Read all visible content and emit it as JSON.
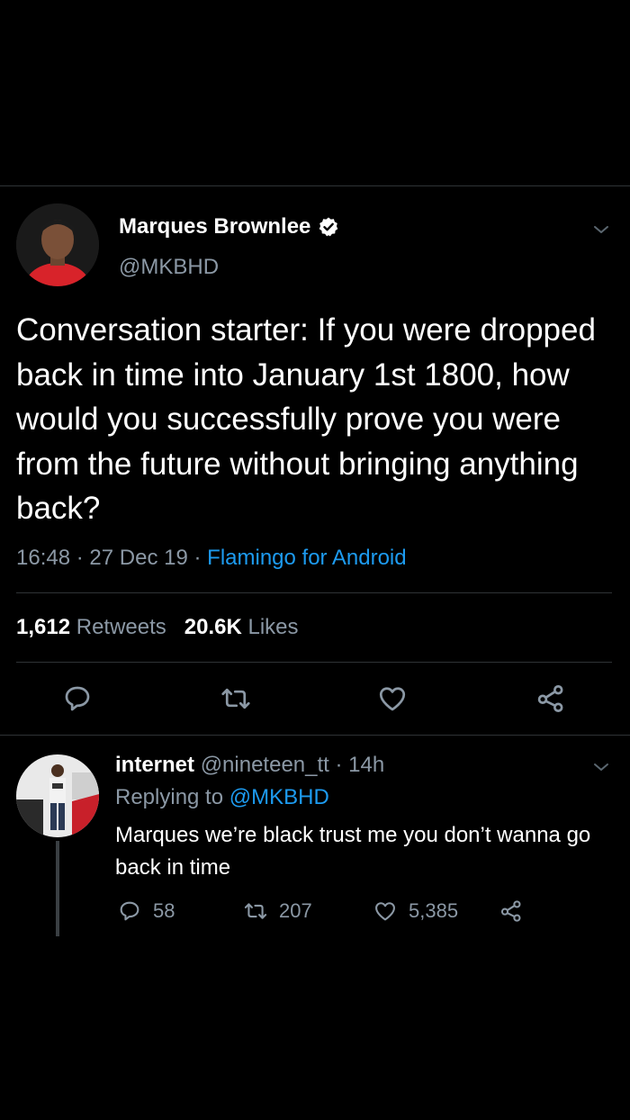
{
  "tweet": {
    "author": {
      "display_name": "Marques Brownlee",
      "handle": "@MKBHD",
      "verified": true
    },
    "text": "Conversation starter: If you were dropped back in time into January 1st 1800, how would you successfully prove you were from the future without bringing anything back?",
    "time": "16:48",
    "date": "27 Dec 19",
    "separator": "·",
    "source_app": "Flamingo for Android",
    "stats": {
      "retweets_count": "1,612",
      "retweets_label": "Retweets",
      "likes_count": "20.6K",
      "likes_label": "Likes"
    },
    "actions": [
      "reply-icon",
      "retweet-icon",
      "like-icon",
      "share-icon"
    ]
  },
  "reply": {
    "display_name": "internet",
    "handle": "@nineteen_tt",
    "separator": "·",
    "age": "14h",
    "replying_prefix": "Replying to",
    "replying_to": "@MKBHD",
    "text": "Marques we’re black trust me you don’t wanna go back in time",
    "counts": {
      "replies": "58",
      "retweets": "207",
      "likes": "5,385"
    }
  },
  "colors": {
    "background": "#000000",
    "text": "#ffffff",
    "secondary": "#8b98a5",
    "accent": "#1d9bf0",
    "divider": "#2f3336",
    "verified_badge": "#ffffff"
  }
}
